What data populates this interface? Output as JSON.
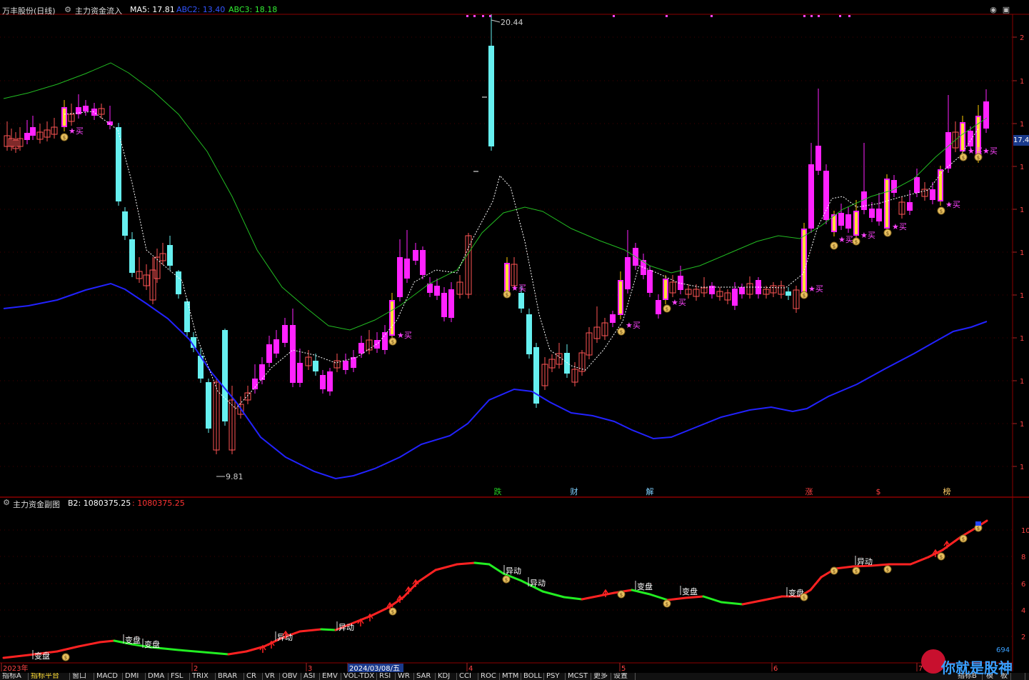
{
  "header": {
    "title": "万丰股份(日线)",
    "indicator": "主力资金流入",
    "ma5": "MA5: 17.81",
    "abc2": "ABC2: 13.40",
    "abc3": "ABC3: 18.18"
  },
  "sub_header": {
    "title": "主力资金副图",
    "b2_label": "B2: 1080375.25",
    "b2_value": ": 1080375.25"
  },
  "annotations": {
    "high": "20.44",
    "low": "9.81",
    "buy": "★买",
    "money": "$",
    "price_tag": "17.4"
  },
  "events": [
    {
      "label": "跌",
      "color": "#22cc22"
    },
    {
      "label": "财",
      "color": "#7fd0ff"
    },
    {
      "label": "解",
      "color": "#7fd0ff"
    },
    {
      "label": "涨",
      "color": "#ff4040"
    },
    {
      "label": "$",
      "color": "#ff4040"
    },
    {
      "label": "榜",
      "color": "#ffcc66"
    }
  ],
  "x_axis": {
    "labels": [
      "2023年",
      "2",
      "3",
      "2024/03/08/五",
      "4",
      "5",
      "6",
      "7"
    ]
  },
  "y_axis_main": [
    "2",
    "1",
    "1",
    "1",
    "1",
    "1",
    "1",
    "1",
    "1",
    "1",
    "1"
  ],
  "y_axis_sub": [
    "10",
    "8",
    "6",
    "4",
    "2"
  ],
  "sub_labels": [
    "变盘",
    "变盘",
    "变盘",
    "异动",
    "异动",
    "变盘",
    "变盘",
    "异动",
    "变盘",
    "异动",
    "异动"
  ],
  "tabs": [
    "指标A",
    "指标平台",
    "窗口",
    "MACD",
    "DMI",
    "DMA",
    "FSL",
    "TRIX",
    "BRAR",
    "CR",
    "VR",
    "OBV",
    "ASI",
    "EMV",
    "VOL-TDX",
    "RSI",
    "WR",
    "SAR",
    "KDJ",
    "CCI",
    "ROC",
    "MTM",
    "BOLL",
    "PSY",
    "MCST",
    "更多",
    "设置",
    "指标B",
    "模",
    "板"
  ],
  "watermark": {
    "text": "你就是股神",
    "num": "694"
  },
  "window_controls": [
    "◉",
    "▣"
  ],
  "colors": {
    "up": "#ff22ff",
    "down": "#66f0f0",
    "small_up": "#ff5555",
    "blue_line": "#2222ff",
    "green_line": "#22bb22",
    "grid_red": "#8b0000",
    "header_ma5": "#ffffff",
    "header_abc2": "#3355ff",
    "header_abc3": "#33ee33"
  }
}
